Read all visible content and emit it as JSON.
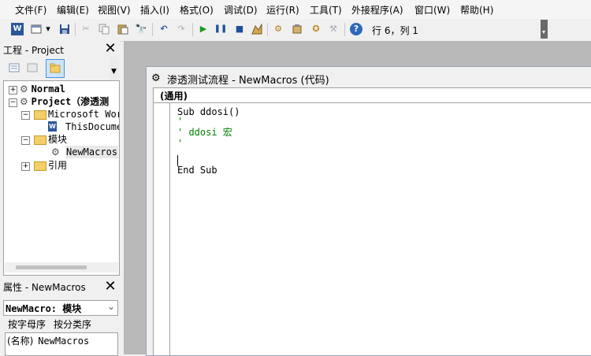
{
  "menu": [
    "文件(F)",
    "编辑(E)",
    "视图(V)",
    "插入(I)",
    "格式(O)",
    "调试(D)",
    "运行(R)",
    "工具(T)",
    "外接程序(A)",
    "窗口(W)",
    "帮助(H)"
  ],
  "toolbar": {
    "position": "行 6，列 1"
  },
  "project": {
    "title": "工程 - Project",
    "tree": {
      "normal": "Normal",
      "project": "Project（渗透测",
      "word_objects": "Microsoft Wor",
      "this_document": "ThisDocume",
      "modules": "模块",
      "newmacros": "NewMacros",
      "references": "引用"
    }
  },
  "properties": {
    "title": "属性 - NewMacros",
    "selected": "NewMacro: 模块",
    "tabs": [
      "按字母序",
      "按分类序"
    ],
    "row_name": "(名称)",
    "row_value": "NewMacros"
  },
  "code_window": {
    "title": "渗透测试流程 - NewMacros (代码)",
    "object": "(通用)",
    "lines": [
      "Sub ddosi()",
      "'",
      "' ddosi 宏",
      "'",
      "",
      "End Sub"
    ]
  },
  "colors": {
    "comment": "#008000",
    "mdi_background": "#b9b9b9"
  }
}
